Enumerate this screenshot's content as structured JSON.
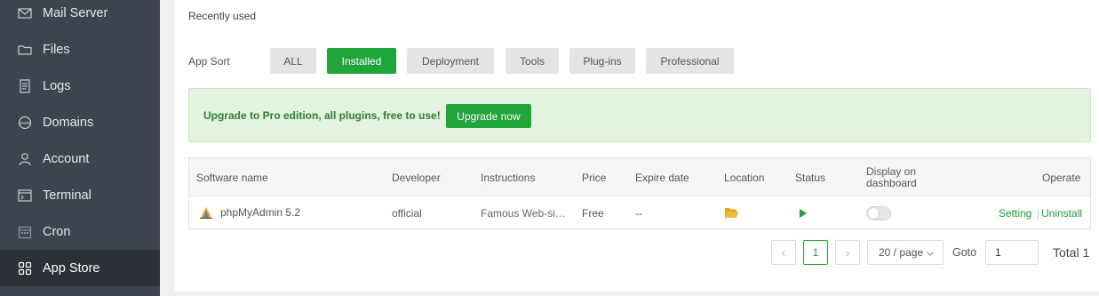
{
  "sidebar": {
    "items": [
      {
        "label": "Mail Server",
        "icon": "mail-icon"
      },
      {
        "label": "Files",
        "icon": "folder-icon"
      },
      {
        "label": "Logs",
        "icon": "log-icon"
      },
      {
        "label": "Domains",
        "icon": "www-icon"
      },
      {
        "label": "Account",
        "icon": "user-icon"
      },
      {
        "label": "Terminal",
        "icon": "terminal-icon"
      },
      {
        "label": "Cron",
        "icon": "calendar-icon"
      },
      {
        "label": "App Store",
        "icon": "grid-icon",
        "active": true
      }
    ]
  },
  "main": {
    "recently_used": "Recently used",
    "app_sort": {
      "label": "App Sort",
      "options": [
        "ALL",
        "Installed",
        "Deployment",
        "Tools",
        "Plug-ins",
        "Professional"
      ],
      "selected": "Installed"
    },
    "banner": {
      "text": "Upgrade to Pro edition, all plugins, free to use!",
      "button": "Upgrade now"
    },
    "table": {
      "headers": {
        "software_name": "Software name",
        "developer": "Developer",
        "instructions": "Instructions",
        "price": "Price",
        "expire_date": "Expire date",
        "location": "Location",
        "status": "Status",
        "display_on_dashboard_1": "Display on",
        "display_on_dashboard_2": "dashboard",
        "operate": "Operate"
      },
      "rows": [
        {
          "name": "phpMyAdmin 5.2",
          "developer": "official",
          "instructions": "Famous Web-si…",
          "price": "Free",
          "expire_date": "--",
          "status": "running",
          "display_on_dashboard": false,
          "setting": "Setting",
          "uninstall": "Uninstall"
        }
      ]
    },
    "pagination": {
      "current_page": "1",
      "page_size": "20 / page",
      "goto_label": "Goto",
      "goto_value": "1",
      "total": "Total 1"
    }
  },
  "colors": {
    "accent": "#20a53a",
    "sidebar_bg": "#3c444d",
    "banner_bg": "#e3f3df"
  }
}
